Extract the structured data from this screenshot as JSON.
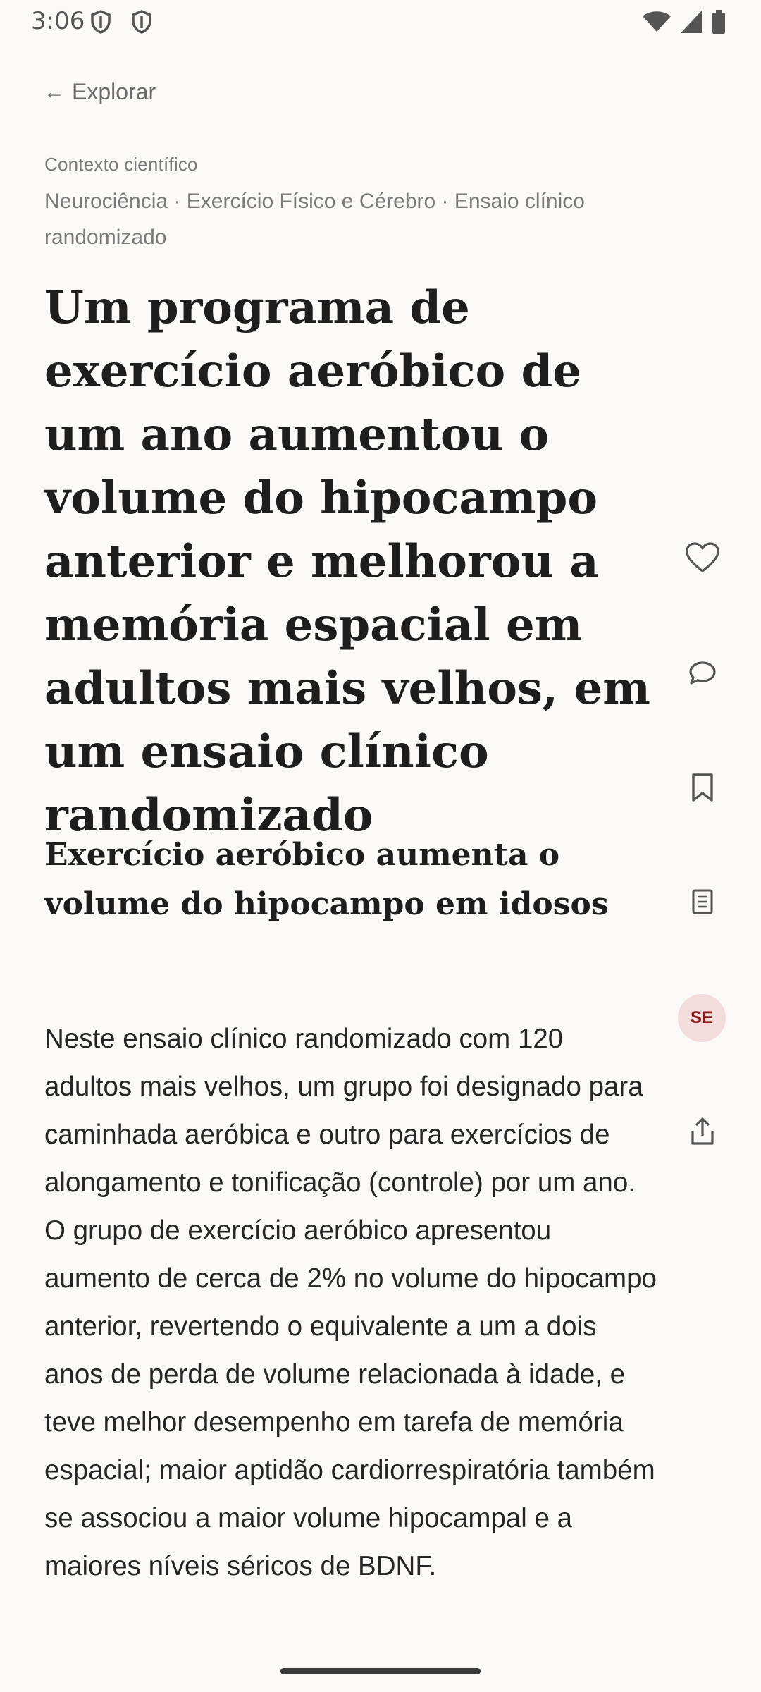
{
  "status_bar": {
    "time": "3:06",
    "left_icons": [
      "shield-icon",
      "shield-icon"
    ],
    "right_icons": [
      "wifi-icon",
      "cellular-signal-icon",
      "battery-icon"
    ]
  },
  "nav": {
    "back_arrow": "←",
    "back_label": "Explorar"
  },
  "article": {
    "context_label": "Contexto científico",
    "breadcrumb": "Neurociência · Exercício Físico e Cérebro · Ensaio clínico randomizado",
    "headline": "Um programa de exercício aeróbico de um ano aumentou o volume do hipocampo anterior e melhorou a memória espacial em adultos mais velhos, em um ensaio clínico randomizado",
    "subheadline": "Exercício aeróbico aumenta o volume do hipocampo em idosos",
    "body": "Neste ensaio clínico randomizado com 120 adultos mais velhos, um grupo foi designado para caminhada aeróbica e outro para exercícios de alongamento e tonificação (controle) por um ano. O grupo de exercício aeróbico apresentou aumento de cerca de 2% no volume do hipocampo anterior, revertendo o equivalente a um a dois anos de perda de volume relacionada à idade, e teve melhor desempenho em tarefa de memória espacial; maior aptidão cardiorrespiratória também se associou a maior volume hipocampal e a maiores níveis séricos de BDNF."
  },
  "actions": {
    "icons": [
      "heart-icon",
      "comment-icon",
      "bookmark-icon",
      "notes-icon",
      "share-icon"
    ],
    "avatar_initials": "SE",
    "accent_color": "#8b1a1a",
    "avatar_bg": "#f2dcdc"
  }
}
